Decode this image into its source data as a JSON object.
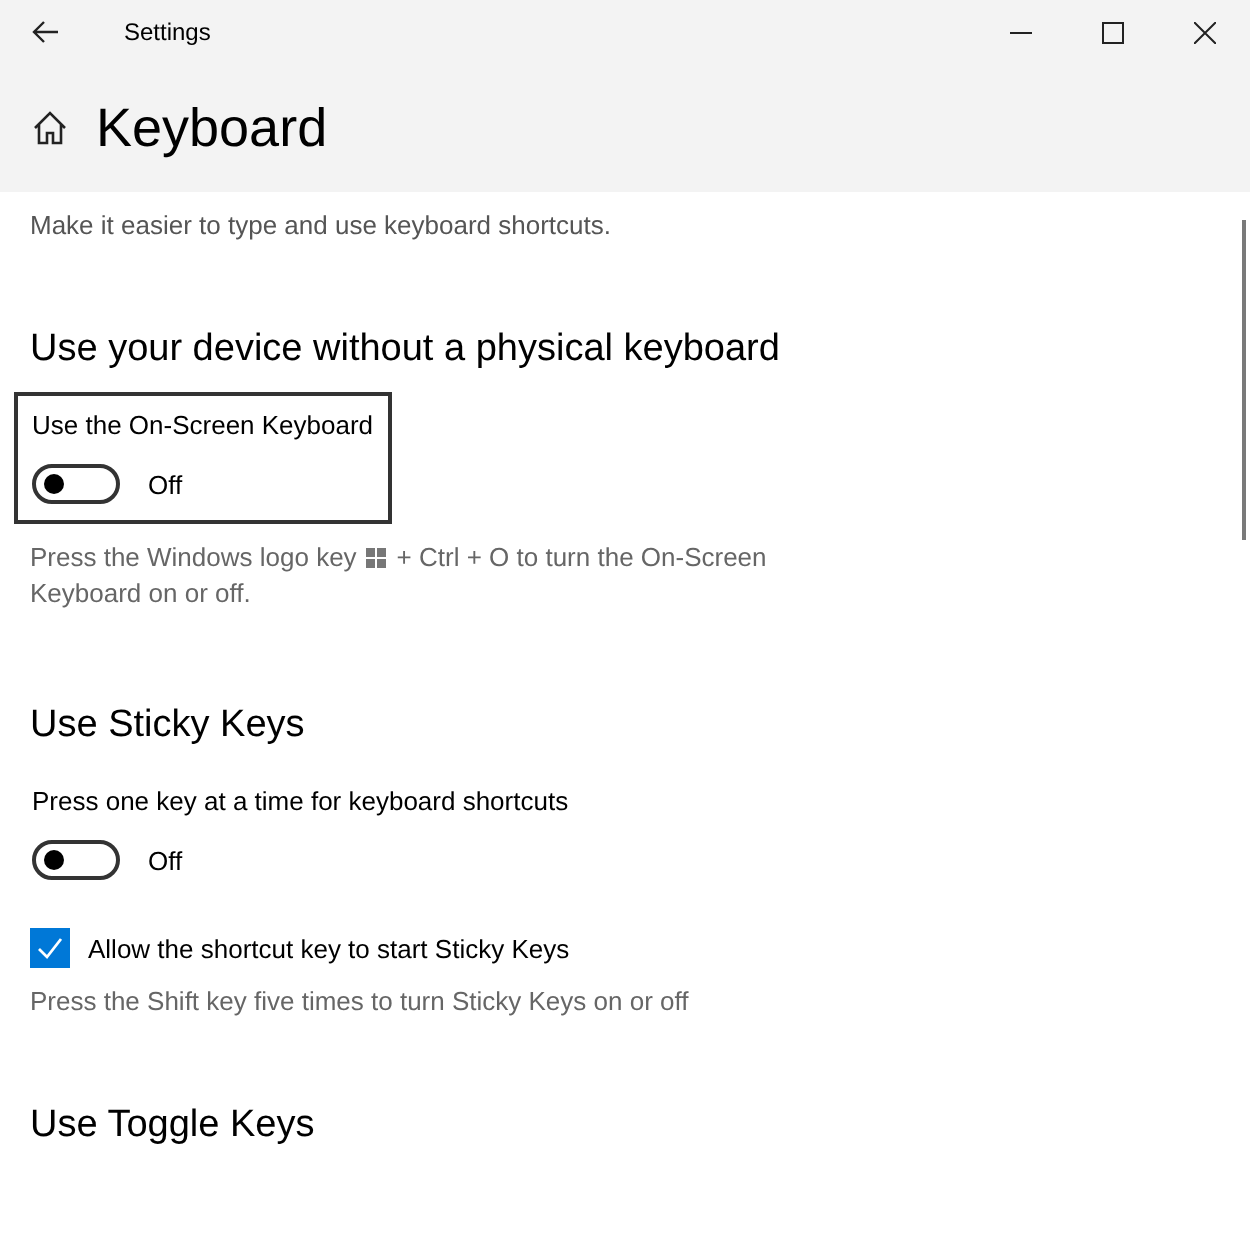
{
  "window": {
    "title": "Settings"
  },
  "page": {
    "title": "Keyboard",
    "intro": "Make it easier to type and use keyboard shortcuts."
  },
  "sections": [
    {
      "heading": "Use your device without a physical keyboard",
      "items": [
        {
          "kind": "toggle",
          "label": "Use the On-Screen Keyboard",
          "on": false,
          "state_text": "Off",
          "focused": true
        },
        {
          "kind": "note",
          "text_before": "Press the Windows logo key",
          "text_after": "+ Ctrl + O to turn the On-Screen",
          "text_continued": "Keyboard on or off."
        }
      ]
    },
    {
      "heading": "Use Sticky Keys",
      "items": [
        {
          "kind": "toggle",
          "label": "Press one key at a time for keyboard shortcuts",
          "on": false,
          "state_text": "Off",
          "focused": false
        },
        {
          "kind": "checkbox",
          "label": "Allow the shortcut key to start Sticky Keys",
          "checked": true
        },
        {
          "kind": "note",
          "text": "Press the Shift key five times to turn Sticky Keys on or off"
        }
      ]
    },
    {
      "heading": "Use Toggle Keys"
    }
  ]
}
